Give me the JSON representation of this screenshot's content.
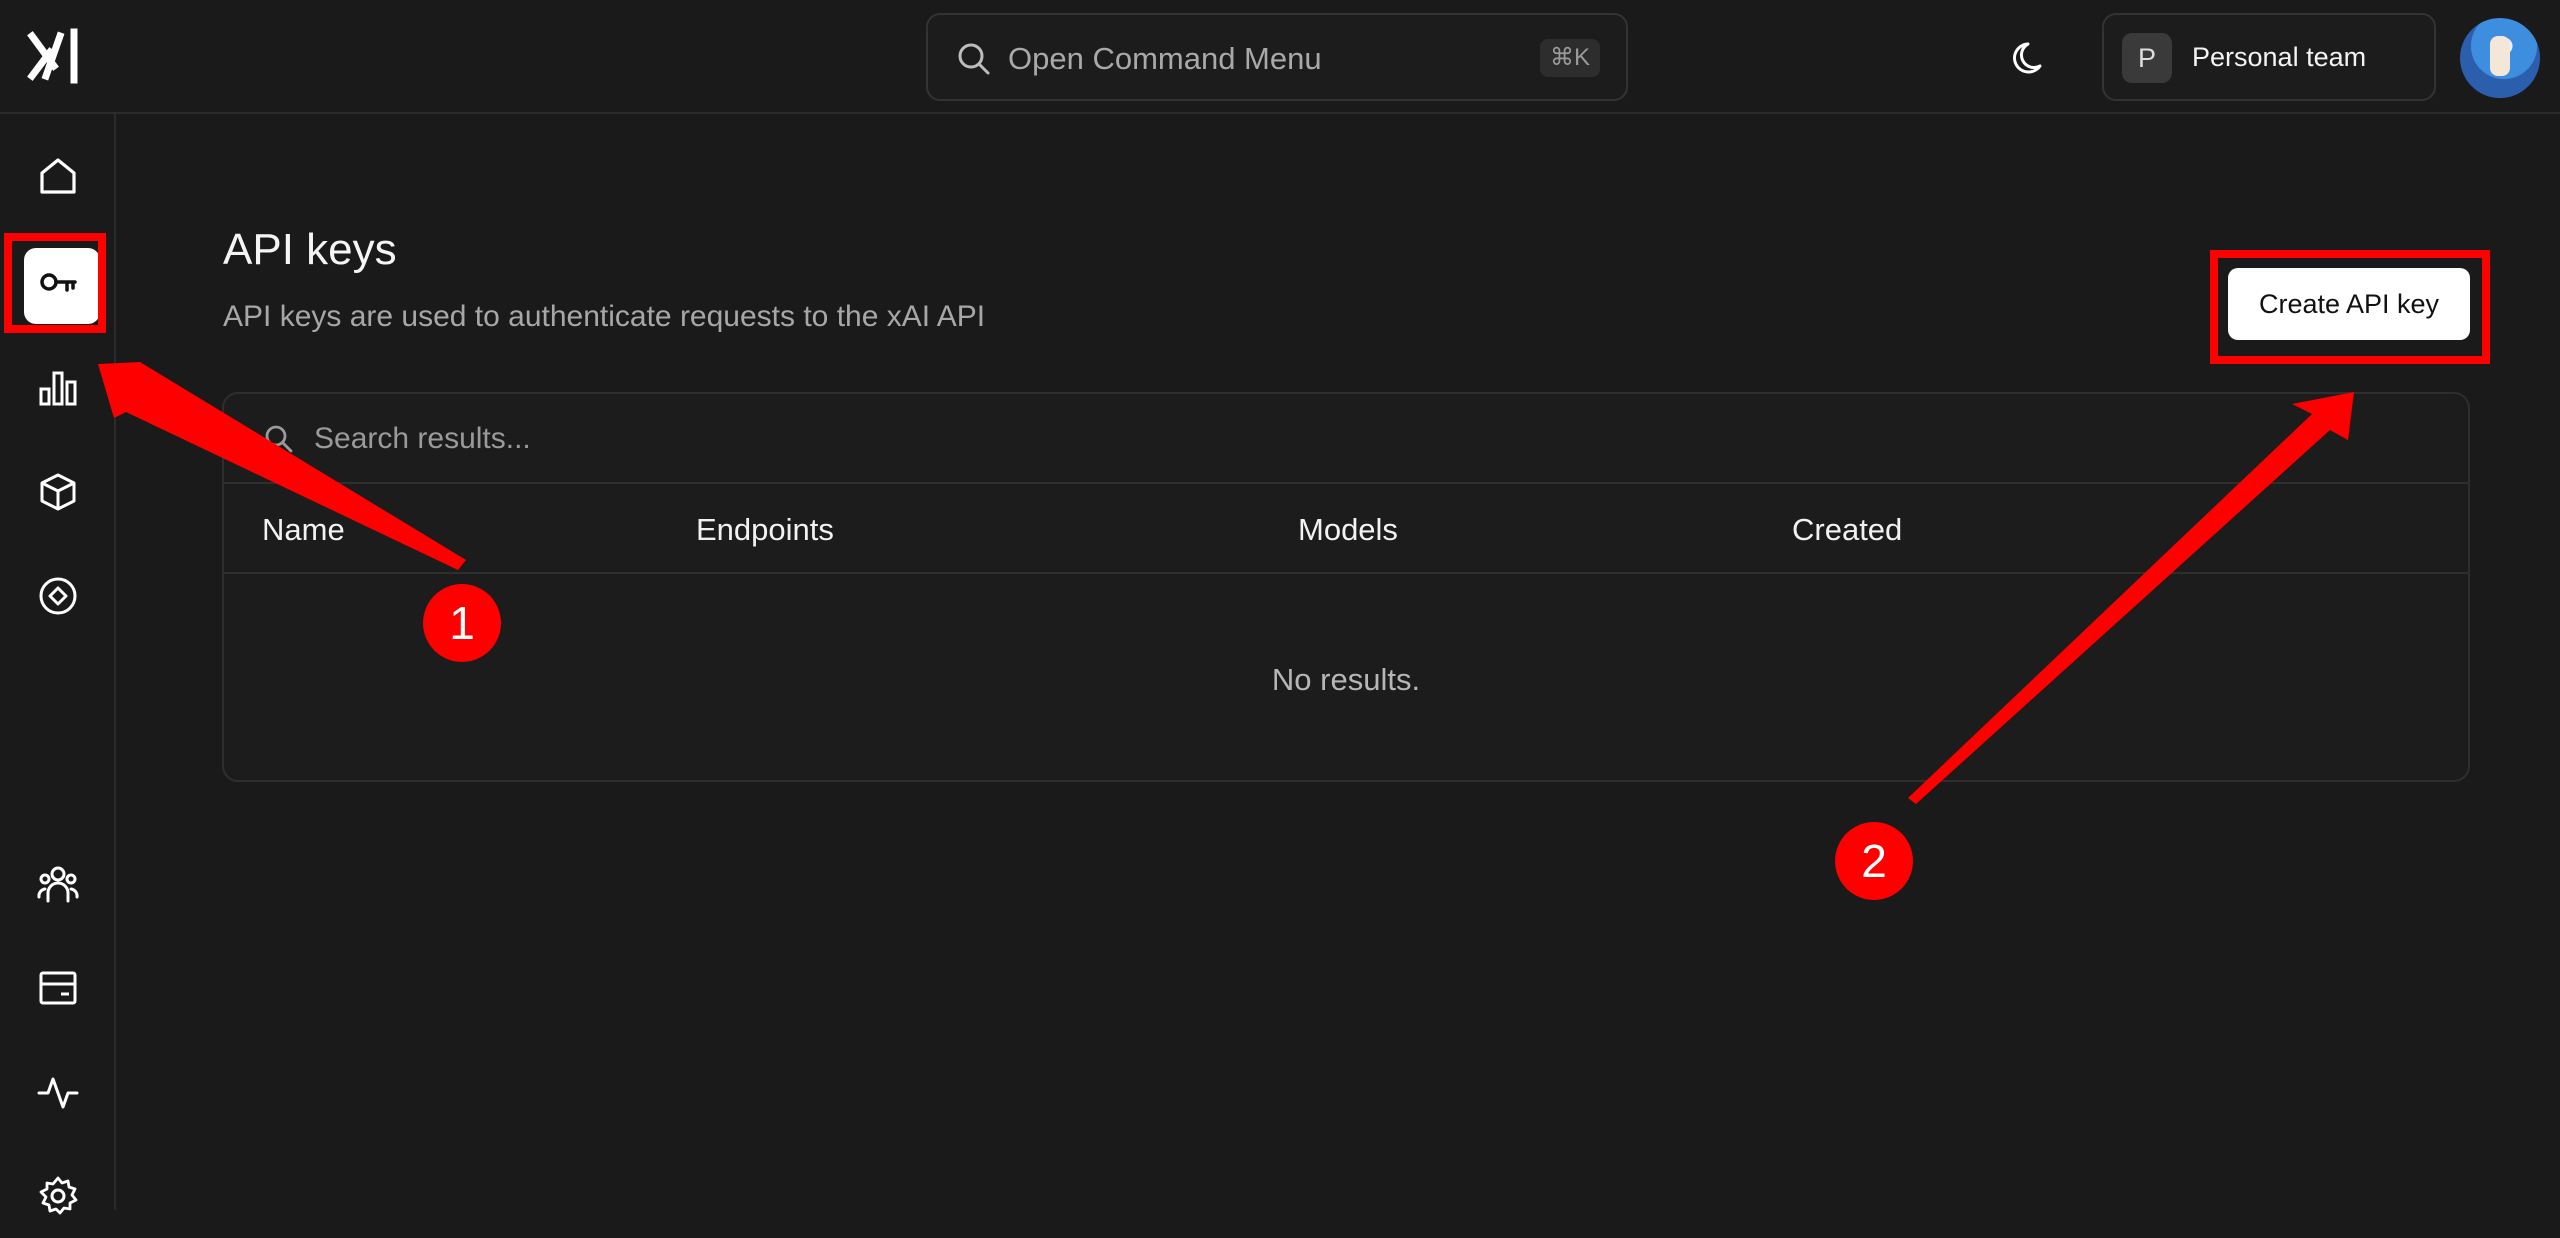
{
  "header": {
    "command_placeholder": "Open Command Menu",
    "command_shortcut": "⌘K",
    "team_initial": "P",
    "team_name": "Personal team"
  },
  "sidebar": {
    "items": [
      {
        "name": "home-icon"
      },
      {
        "name": "key-icon",
        "active": true
      },
      {
        "name": "bar-chart-icon"
      },
      {
        "name": "cube-icon"
      },
      {
        "name": "compass-icon"
      },
      {
        "name": "team-icon"
      },
      {
        "name": "billing-card-icon"
      },
      {
        "name": "activity-icon"
      },
      {
        "name": "settings-gear-icon"
      }
    ]
  },
  "main": {
    "title": "API keys",
    "subtitle": "API keys are used to authenticate requests to the xAI API",
    "create_button": "Create API key",
    "search_placeholder": "Search results...",
    "columns": [
      "Name",
      "Endpoints",
      "Models",
      "Created"
    ],
    "empty_text": "No results."
  },
  "annotations": {
    "step1": "1",
    "step2": "2",
    "color": "#ff0000"
  }
}
